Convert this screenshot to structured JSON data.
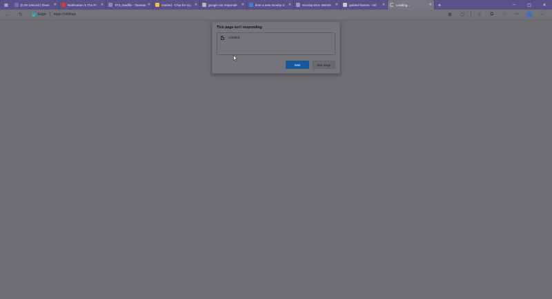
{
  "tabs": [
    {
      "title": "[C3S Discord | Reac",
      "color": "#6b6fb5",
      "icon": "discord-icon"
    },
    {
      "title": "Notification X The Fr",
      "color": "#d43c3c",
      "icon": "gmail-icon"
    },
    {
      "title": "TFS_Radlfix - Teamus",
      "color": "#8c8aa8",
      "icon": "page-icon"
    },
    {
      "title": "Guided - Chat for Gu",
      "color": "#f5c247",
      "icon": "chat-icon"
    },
    {
      "title": "google not respondir",
      "color": "#b5b3c4",
      "icon": "search-icon"
    },
    {
      "title": "time a new scooby d",
      "color": "#3d7fcf",
      "icon": "edge-icon"
    },
    {
      "title": "Scooby-Doo: Mmmh",
      "color": "#9c96b8",
      "icon": "page-icon"
    },
    {
      "title": "guided-frames - Gri",
      "color": "#c9c6da",
      "icon": "github-icon"
    },
    {
      "title": "Loading...",
      "color": "#cfcfcf",
      "icon": "loading-icon",
      "active": true
    }
  ],
  "address": {
    "brand": "Edge",
    "url": "edge://settings"
  },
  "dialog": {
    "title": "This page isn't responding",
    "page_name": "Untitled",
    "wait_label": "Wait",
    "exit_label": "Exit page"
  }
}
